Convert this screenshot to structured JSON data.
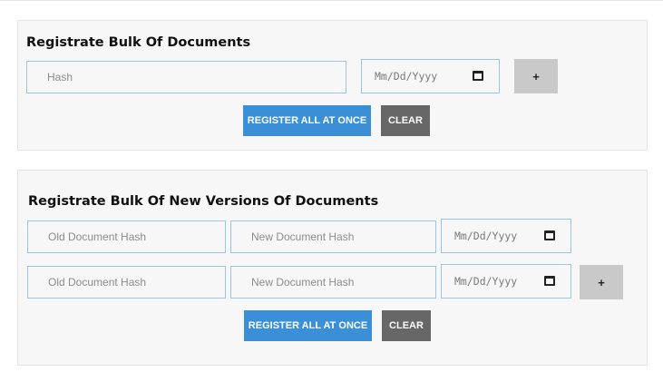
{
  "bulk_documents": {
    "title": "Registrate Bulk Of Documents",
    "hash_placeholder": "Hash",
    "date_placeholder": "Mm/Dd/Yyyy",
    "add_label": "+",
    "register_label": "REGISTER ALL AT ONCE",
    "clear_label": "CLEAR"
  },
  "bulk_versions": {
    "title": "Registrate Bulk Of New Versions Of Documents",
    "rows": [
      {
        "old_placeholder": "Old Document Hash",
        "new_placeholder": "New Document Hash",
        "date_placeholder": "Mm/Dd/Yyyy"
      },
      {
        "old_placeholder": "Old Document Hash",
        "new_placeholder": "New Document Hash",
        "date_placeholder": "Mm/Dd/Yyyy"
      }
    ],
    "add_label": "+",
    "register_label": "REGISTER ALL AT ONCE",
    "clear_label": "CLEAR"
  },
  "icons": {
    "date_picker": "calendar-icon"
  }
}
